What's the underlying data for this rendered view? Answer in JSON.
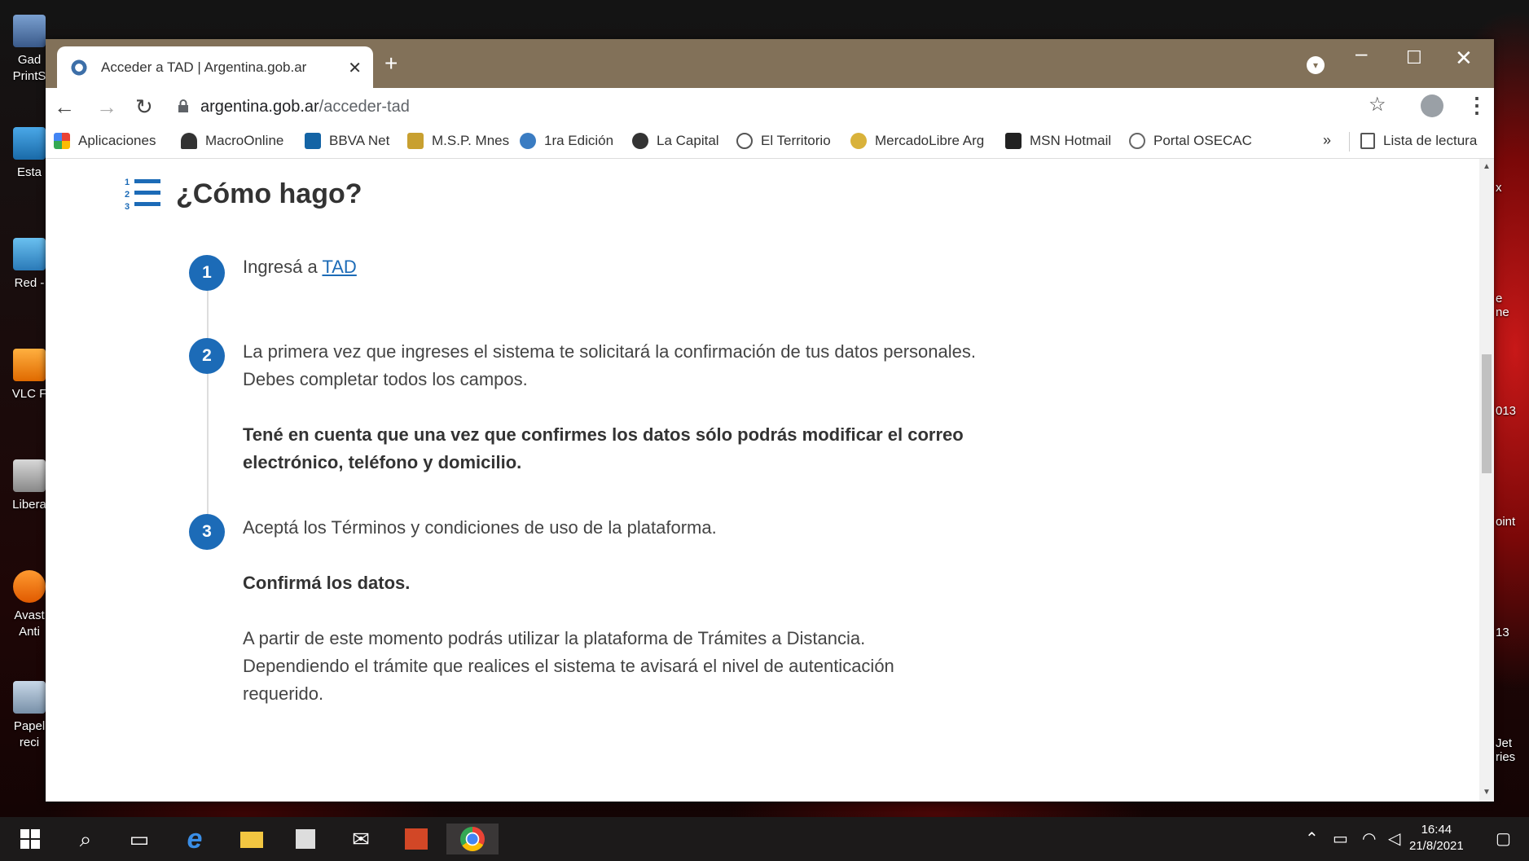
{
  "desktop": {
    "icons": [
      {
        "label": "Gad\nPrintS",
        "icon": "printer-shortcut-icon"
      },
      {
        "label": "Esta",
        "icon": "this-pc-icon"
      },
      {
        "label": "Red -",
        "icon": "network-icon"
      },
      {
        "label": "VLC F",
        "icon": "vlc-icon"
      },
      {
        "label": "Libera",
        "icon": "liberation-icon"
      },
      {
        "label": "Avast\nAnti",
        "icon": "avast-icon"
      },
      {
        "label": "Papel\nreci",
        "icon": "recycle-bin-icon"
      }
    ],
    "right_fragments": [
      "x",
      "e\nne",
      "013",
      "oint",
      "13",
      "Jet\nries"
    ]
  },
  "browser": {
    "tab_title": "Acceder a TAD | Argentina.gob.ar",
    "tab_close": "✕",
    "new_tab": "+",
    "url_host": "argentina.gob.ar",
    "url_path": "/acceder-tad",
    "bookmarks": [
      {
        "label": "Aplicaciones",
        "icon": "apps-grid-icon",
        "color": "#e94235"
      },
      {
        "label": "MacroOnline",
        "icon": "macro-icon",
        "color": "#333333"
      },
      {
        "label": "BBVA Net",
        "icon": "bbva-icon",
        "color": "#1464a5"
      },
      {
        "label": "M.S.P. Mnes",
        "icon": "msp-icon",
        "color": "#c8a030"
      },
      {
        "label": "1ra Edición",
        "icon": "primera-edicion-icon",
        "color": "#3a7cc2"
      },
      {
        "label": "La Capital",
        "icon": "la-capital-icon",
        "color": "#333333"
      },
      {
        "label": "El Territorio",
        "icon": "el-territorio-icon",
        "color": "#555555"
      },
      {
        "label": "MercadoLibre Arg",
        "icon": "mercadolibre-icon",
        "color": "#d9b23a"
      },
      {
        "label": "MSN Hotmail",
        "icon": "msn-icon",
        "color": "#222222"
      },
      {
        "label": "Portal OSECAC",
        "icon": "osecac-icon",
        "color": "#666666"
      }
    ],
    "bookmarks_more": "»",
    "reading_list": "Lista de lectura"
  },
  "page": {
    "title": "¿Cómo hago?",
    "steps": [
      {
        "number": "1",
        "text_before_link": "Ingresá a ",
        "link": "TAD"
      },
      {
        "number": "2",
        "line1": "La primera vez que ingreses el sistema te solicitará la confirmación de tus datos personales.",
        "line2": "Debes completar todos los campos.",
        "bold1": "Tené en cuenta que una vez que confirmes los datos sólo podrás modificar el correo",
        "bold2": "electrónico, teléfono y domicilio."
      },
      {
        "number": "3",
        "line1": "Aceptá los Términos y condiciones de uso de la plataforma.",
        "bold": "Confirmá los datos.",
        "para1": "A partir de este momento podrás utilizar la plataforma de Trámites a Distancia.",
        "para2": "Dependiendo el trámite que realices el sistema te avisará el nivel de autenticación",
        "para3": "requerido."
      }
    ]
  },
  "taskbar": {
    "time": "16:44",
    "date": "21/8/2021"
  },
  "colors": {
    "titlebar": "#827159",
    "accent_blue": "#1c6bb7"
  }
}
